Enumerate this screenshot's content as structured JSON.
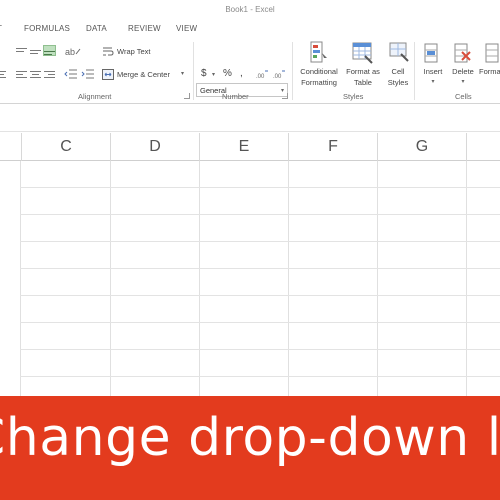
{
  "window": {
    "title": "Book1 - Excel"
  },
  "tabs": [
    {
      "label": "FORMULAS"
    },
    {
      "label": "DATA"
    },
    {
      "label": "REVIEW"
    },
    {
      "label": "VIEW"
    }
  ],
  "ribbon": {
    "alignment": {
      "wrap_text": "Wrap Text",
      "merge_center": "Merge & Center",
      "label": "Alignment"
    },
    "number": {
      "format_value": "General",
      "currency": "$",
      "percent": "%",
      "comma": ",",
      "label": "Number"
    },
    "styles": {
      "conditional_formatting_line1": "Conditional",
      "conditional_formatting_line2": "Formatting",
      "format_as_table_line1": "Format as",
      "format_as_table_line2": "Table",
      "cell_styles_line1": "Cell",
      "cell_styles_line2": "Styles",
      "label": "Styles"
    },
    "cells": {
      "insert": "Insert",
      "delete": "Delete",
      "format": "Forma",
      "label": "Cells"
    }
  },
  "columns": [
    "C",
    "D",
    "E",
    "F",
    "G"
  ],
  "banner": {
    "caption": "Change drop-down list"
  },
  "colors": {
    "banner": "#e33b1e",
    "accent_green": "#217346"
  }
}
